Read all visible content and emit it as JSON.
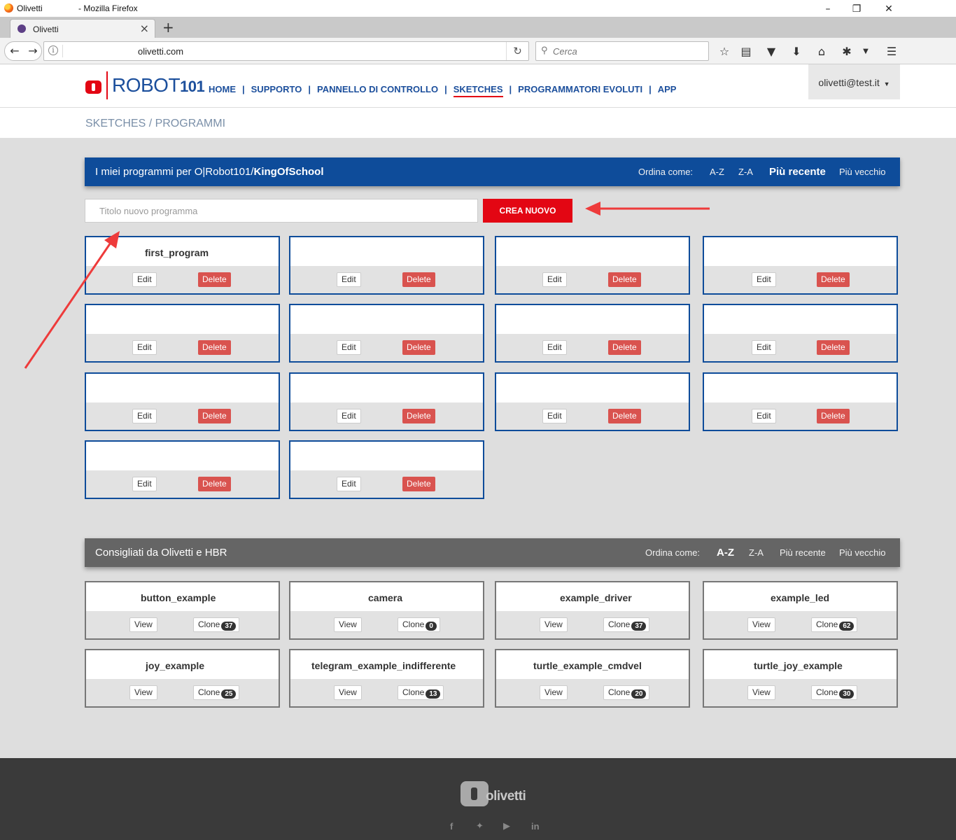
{
  "browser": {
    "window_title_left": "Olivetti",
    "window_title_right": "- Mozilla Firefox",
    "tab_title": "Olivetti",
    "url": "olivetti.com",
    "search_placeholder": "Cerca"
  },
  "header": {
    "logo_text": "ROBOT",
    "logo_num": "101",
    "nav": [
      {
        "label": "HOME"
      },
      {
        "label": "SUPPORTO"
      },
      {
        "label": "PANNELLO DI CONTROLLO"
      },
      {
        "label": "SKETCHES"
      },
      {
        "label": "PROGRAMMATORI EVOLUTI"
      },
      {
        "label": "APP"
      }
    ],
    "user": "olivetti@test.it"
  },
  "breadcrumb": "SKETCHES / PROGRAMMI",
  "my_programs": {
    "title_prefix": "I miei programmi per O|Robot101/",
    "title_bold": "KingOfSchool",
    "sort_label": "Ordina come:",
    "sort_options": [
      "A-Z",
      "Z-A",
      "Più recente",
      "Più vecchio"
    ],
    "sort_active": "Più recente",
    "new_placeholder": "Titolo nuovo programma",
    "create_label": "CREA NUOVO",
    "edit_label": "Edit",
    "delete_label": "Delete",
    "programs": [
      "first_program",
      "",
      "",
      "",
      "",
      "",
      "",
      "",
      "",
      "",
      "",
      "",
      "",
      ""
    ]
  },
  "recommended": {
    "title": "Consigliati da Olivetti e HBR",
    "sort_label": "Ordina come:",
    "sort_options": [
      "A-Z",
      "Z-A",
      "Più recente",
      "Più vecchio"
    ],
    "sort_active": "A-Z",
    "view_label": "View",
    "clone_label": "Clone",
    "items": [
      {
        "name": "button_example",
        "clones": "37"
      },
      {
        "name": "camera",
        "clones": "0"
      },
      {
        "name": "example_driver",
        "clones": "37"
      },
      {
        "name": "example_led",
        "clones": "62"
      },
      {
        "name": "joy_example",
        "clones": "25"
      },
      {
        "name": "telegram_example_indifferente",
        "clones": "13"
      },
      {
        "name": "turtle_example_cmdvel",
        "clones": "20"
      },
      {
        "name": "turtle_joy_example",
        "clones": "30"
      }
    ]
  },
  "footer": {
    "logo_text": "olivetti",
    "social": [
      "f",
      "t",
      "yt",
      "in"
    ]
  },
  "colors": {
    "brand_blue": "#0e4c9a",
    "brand_red": "#e30613",
    "annotation_arrow": "#ee3b3b"
  }
}
